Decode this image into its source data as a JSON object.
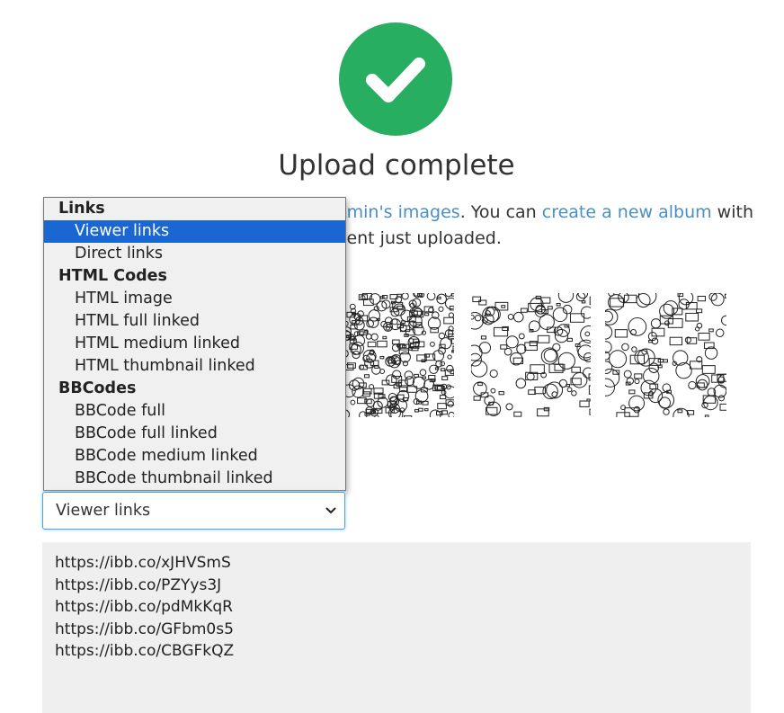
{
  "header": {
    "status_icon": "checkmark-circle-icon",
    "status_color": "#27ae60",
    "title": "Upload complete"
  },
  "message": {
    "link_user_images": "Amin's images",
    "text_you_can": ". You can ",
    "link_create_album": "create a new album",
    "text_with": " with",
    "line2": "tent just uploaded.",
    "link_color": "#4a8fc3"
  },
  "dropdown": {
    "selected": "Viewer links",
    "groups": [
      {
        "label": "Links",
        "options": [
          "Viewer links",
          "Direct links"
        ]
      },
      {
        "label": "HTML Codes",
        "options": [
          "HTML image",
          "HTML full linked",
          "HTML medium linked",
          "HTML thumbnail linked"
        ]
      },
      {
        "label": "BBCodes",
        "options": [
          "BBCode full",
          "BBCode full linked",
          "BBCode medium linked",
          "BBCode thumbnail linked"
        ]
      }
    ],
    "highlight_color": "#1a66d2"
  },
  "links": [
    "https://ibb.co/xJHVSmS",
    "https://ibb.co/PZYys3J",
    "https://ibb.co/pdMkKqR",
    "https://ibb.co/GFbm0s5",
    "https://ibb.co/CBGFkQZ"
  ]
}
